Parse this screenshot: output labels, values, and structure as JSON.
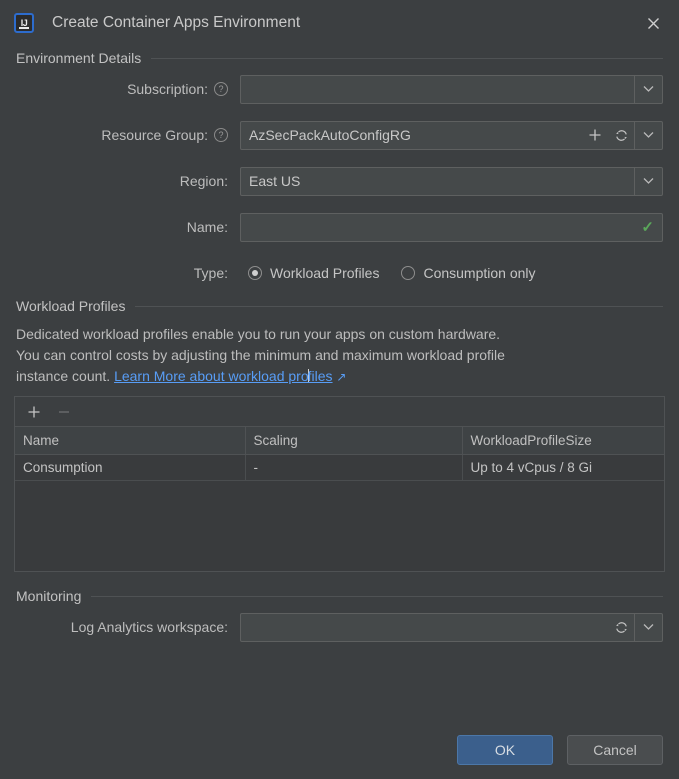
{
  "window": {
    "title": "Create Container Apps Environment",
    "app_icon": "intellij-idea-icon",
    "close_label": "✕"
  },
  "sections": {
    "environment_details": "Environment Details",
    "workload_profiles": "Workload Profiles",
    "monitoring": "Monitoring"
  },
  "fields": {
    "subscription": {
      "label": "Subscription:",
      "value": "",
      "help": "?"
    },
    "resource_group": {
      "label": "Resource Group:",
      "value": "AzSecPackAutoConfigRG",
      "help": "?"
    },
    "region": {
      "label": "Region:",
      "value": "East US"
    },
    "name": {
      "label": "Name:",
      "value": "",
      "valid_mark": "✓"
    },
    "type": {
      "label": "Type:"
    },
    "log_analytics": {
      "label": "Log Analytics workspace:",
      "value": ""
    }
  },
  "type_options": [
    {
      "label": "Workload Profiles",
      "selected": true
    },
    {
      "label": "Consumption only",
      "selected": false
    }
  ],
  "description": {
    "line1": "Dedicated workload profiles enable you to run your apps on custom hardware.",
    "line2": "You can control costs by adjusting the minimum and maximum workload profile",
    "line3_prefix": "instance count. ",
    "link_part1": "Learn More about workload pro",
    "link_part2": "files",
    "link_arrow": "↗"
  },
  "table_toolbar": {
    "add": "+",
    "remove": "−"
  },
  "table": {
    "columns": [
      "Name",
      "Scaling",
      "WorkloadProfileSize"
    ],
    "rows": [
      [
        "Consumption",
        "-",
        "Up to 4 vCpus / 8 Gi"
      ]
    ]
  },
  "buttons": {
    "ok": "OK",
    "cancel": "Cancel"
  },
  "colors": {
    "background": "#3c3f41",
    "field": "#45494a",
    "accent_link": "#589df6",
    "primary_button": "#3b5f8c",
    "valid_green": "#5aa75a"
  }
}
